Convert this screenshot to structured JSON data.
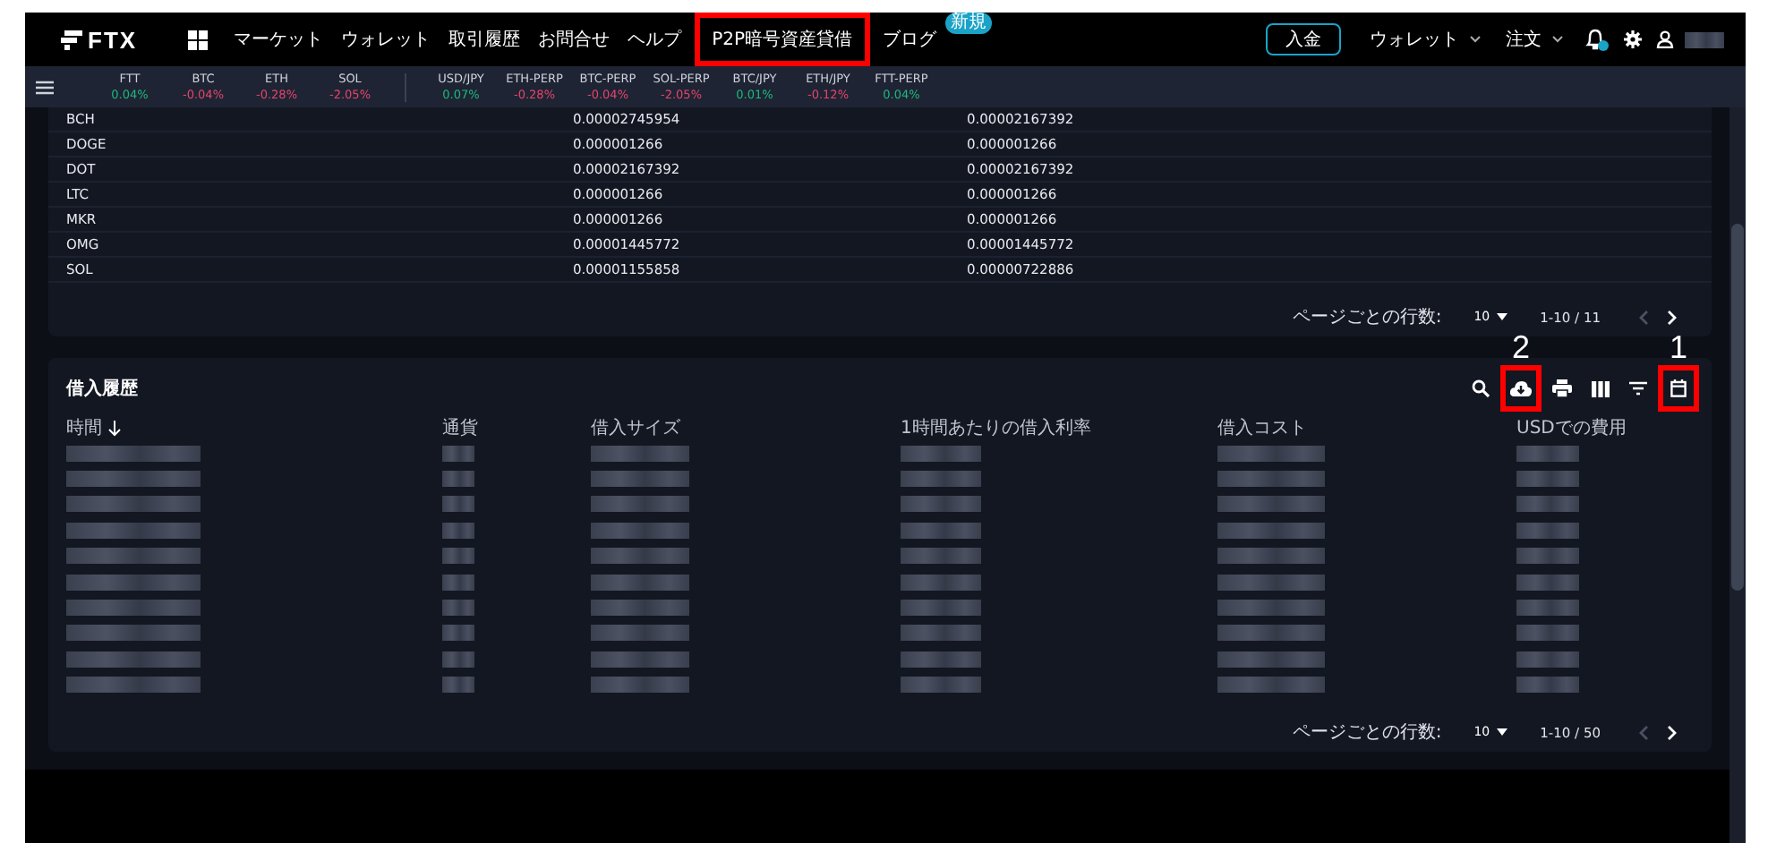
{
  "nav": {
    "logo": "FTX",
    "items": [
      {
        "label": "マーケット",
        "highlighted": false
      },
      {
        "label": "ウォレット",
        "highlighted": false
      },
      {
        "label": "取引履歴",
        "highlighted": false
      },
      {
        "label": "お問合せ",
        "highlighted": false
      },
      {
        "label": "ヘルプ",
        "highlighted": false
      },
      {
        "label": "P2P暗号資産貸借",
        "highlighted": true
      },
      {
        "label": "ブログ",
        "highlighted": false,
        "badge": "新規"
      }
    ],
    "deposit": "入金",
    "wallet_menu": "ウォレット",
    "order_menu": "注文"
  },
  "tickers": {
    "coins": [
      {
        "symbol": "FTT",
        "change": "0.04%",
        "color": "#1fb77f"
      },
      {
        "symbol": "BTC",
        "change": "-0.04%",
        "color": "#e5456d"
      },
      {
        "symbol": "ETH",
        "change": "-0.28%",
        "color": "#e5456d"
      },
      {
        "symbol": "SOL",
        "change": "-2.05%",
        "color": "#e5456d"
      }
    ],
    "markets": [
      {
        "symbol": "USD/JPY",
        "change": "0.07%",
        "color": "#1fb77f"
      },
      {
        "symbol": "ETH-PERP",
        "change": "-0.28%",
        "color": "#e5456d"
      },
      {
        "symbol": "BTC-PERP",
        "change": "-0.04%",
        "color": "#e5456d"
      },
      {
        "symbol": "SOL-PERP",
        "change": "-2.05%",
        "color": "#e5456d"
      },
      {
        "symbol": "BTC/JPY",
        "change": "0.01%",
        "color": "#1fb77f"
      },
      {
        "symbol": "ETH/JPY",
        "change": "-0.12%",
        "color": "#e5456d"
      },
      {
        "symbol": "FTT-PERP",
        "change": "0.04%",
        "color": "#1fb77f"
      }
    ]
  },
  "rates_table": {
    "rows": [
      {
        "coin": "BCH",
        "column_2": "0.00002745954",
        "column_3": "0.00002167392"
      },
      {
        "coin": "DOGE",
        "column_2": "0.000001266",
        "column_3": "0.000001266"
      },
      {
        "coin": "DOT",
        "column_2": "0.00002167392",
        "column_3": "0.00002167392"
      },
      {
        "coin": "LTC",
        "column_2": "0.000001266",
        "column_3": "0.000001266"
      },
      {
        "coin": "MKR",
        "column_2": "0.000001266",
        "column_3": "0.000001266"
      },
      {
        "coin": "OMG",
        "column_2": "0.00001445772",
        "column_3": "0.00001445772"
      },
      {
        "coin": "SOL",
        "column_2": "0.00001155858",
        "column_3": "0.00000722886"
      }
    ],
    "pagination": {
      "rows_per_page_label": "ページごとの行数:",
      "rows_per_page": "10",
      "range": "1-10 / 11",
      "prev_disabled": true,
      "next_disabled": false
    }
  },
  "borrow_history": {
    "title": "借入履歴",
    "toolbar": [
      {
        "kind": "search",
        "highlighted": false
      },
      {
        "kind": "download",
        "highlighted": true,
        "callout": "2"
      },
      {
        "kind": "print",
        "highlighted": false
      },
      {
        "kind": "columns",
        "highlighted": false
      },
      {
        "kind": "filter",
        "highlighted": false
      },
      {
        "kind": "calendar",
        "highlighted": true,
        "callout": "1"
      }
    ],
    "columns": [
      {
        "label": "時間",
        "sorted": true
      },
      {
        "label": "通貨",
        "sorted": false
      },
      {
        "label": "借入サイズ",
        "sorted": false
      },
      {
        "label": "1時間あたりの借入利率",
        "sorted": false
      },
      {
        "label": "借入コスト",
        "sorted": false
      },
      {
        "label": "USDでの費用",
        "sorted": false
      }
    ],
    "rows": [
      {
        "redacted": true
      },
      {
        "redacted": true
      },
      {
        "redacted": true
      },
      {
        "redacted": true
      },
      {
        "redacted": true
      },
      {
        "redacted": true
      },
      {
        "redacted": true
      },
      {
        "redacted": true
      },
      {
        "redacted": true
      },
      {
        "redacted": true
      }
    ],
    "pagination": {
      "rows_per_page_label": "ページごとの行数:",
      "rows_per_page": "10",
      "range": "1-10 / 50",
      "prev_disabled": true,
      "next_disabled": false
    }
  }
}
